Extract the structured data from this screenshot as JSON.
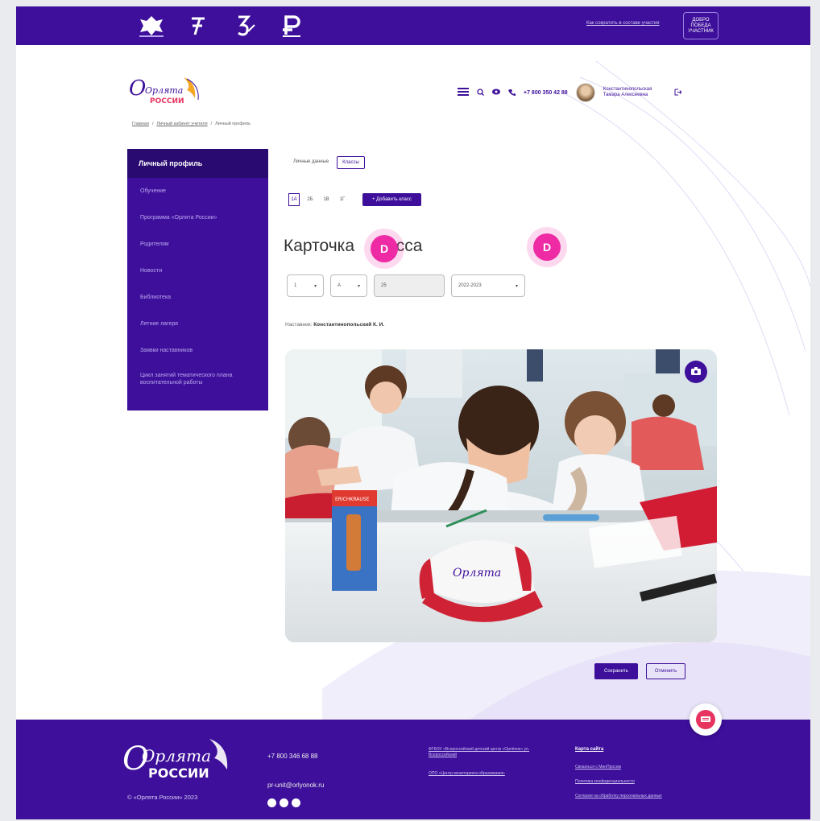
{
  "topbar": {
    "partner_logos": [
      "emblem-logo",
      "digital-logo",
      "culture-logo",
      "rutube-logo"
    ],
    "link": "Как сократить в составе участия",
    "badge_lines": [
      "ДОБРО",
      "ПОБЕДА",
      "УЧАСТНИК"
    ]
  },
  "brand": {
    "logo_line1": "Орлята",
    "logo_line2": "РОССИИ"
  },
  "header": {
    "phone": "+7 800 350 42 88",
    "user_name": "Константинопольская Тамара Алексеевна"
  },
  "breadcrumb": [
    "Главная",
    "/",
    "Личный кабинет учителя",
    "/",
    "Личный профиль"
  ],
  "sidebar": {
    "active": "Личный профиль",
    "items": [
      "Обучение",
      "Программа «Орлята России»",
      "Родителям",
      "Новости",
      "Библиотека",
      "Летние лагеря",
      "Заявки наставников",
      "Цикл занятий тематического плана воспитательной работы"
    ]
  },
  "tabs": [
    "Личные данные",
    "Классы"
  ],
  "grades": [
    "1А",
    "2Б",
    "1В",
    "1Г"
  ],
  "add_class_label": "+ Добавить класс",
  "card_title_start": "Карточка",
  "card_title_end": "сса",
  "badge_letter": "D",
  "fields": [
    {
      "value": "1",
      "readonly": false,
      "dropdown": true
    },
    {
      "value": "А",
      "readonly": false,
      "dropdown": true
    },
    {
      "value": "25",
      "readonly": true,
      "dropdown": false
    },
    {
      "value": "2022-2023",
      "readonly": false,
      "dropdown": true
    }
  ],
  "mentor_label": "Наставник:",
  "mentor_name": "Константинопольский К. И.",
  "cap_text": "Орлята",
  "box_text": "ERICHKRAUSE",
  "actions": {
    "save": "Сохранить",
    "cancel": "Отменить"
  },
  "footer": {
    "logo_line1": "Орлята",
    "logo_line2": "РОССИИ",
    "copyright": "© «Орлята России» 2023",
    "phone": "+7 800 346 68 88",
    "email": "pr-unit@orlyonok.ru",
    "docs": [
      "ФГБОУ «Всероссийский детский центр «Орлёнок» ул. Всероссийский",
      "ОПО «Центр мониторинга образования»"
    ],
    "sitemap_label": "Карта сайта",
    "links": [
      "Связаться с МинПросом",
      "Политика конфиденциальности",
      "Согласие на обработку персональных данных"
    ]
  },
  "colors": {
    "primary": "#3d0f9a",
    "accent_pink": "#ee2ba5",
    "accent_red": "#e6335f"
  }
}
